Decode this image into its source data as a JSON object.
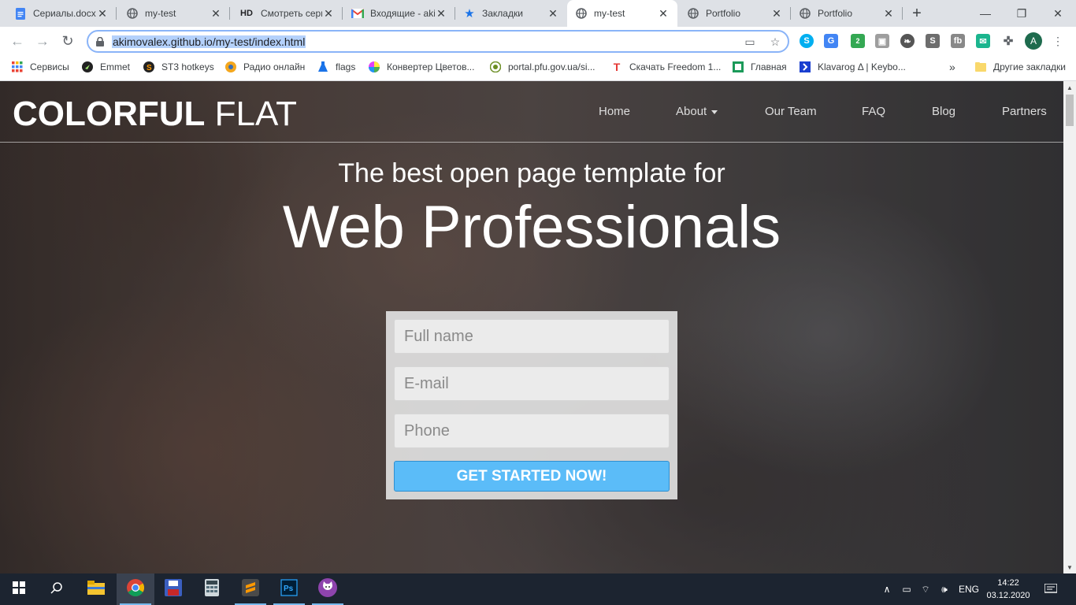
{
  "browser": {
    "tabs": [
      {
        "title": "Сериалы.docx - Google",
        "icon": "google-docs-icon",
        "color": "#4285f4"
      },
      {
        "title": "my-test",
        "icon": "globe-icon"
      },
      {
        "title": "Смотреть сериалы",
        "icon": "hd-icon"
      },
      {
        "title": "Входящие - akimov",
        "icon": "gmail-icon"
      },
      {
        "title": "Закладки",
        "icon": "star-icon"
      },
      {
        "title": "my-test",
        "icon": "globe-icon",
        "active": true
      },
      {
        "title": "Portfolio",
        "icon": "globe-icon"
      },
      {
        "title": "Portfolio",
        "icon": "globe-icon"
      }
    ],
    "url": "akimovalex.github.io/my-test/index.html",
    "profile_initial": "A",
    "extension_badge": "2",
    "bookmarks": [
      {
        "label": "Сервисы",
        "icon": "apps-grid-icon"
      },
      {
        "label": "Emmet",
        "icon": "emmet-icon"
      },
      {
        "label": "ST3 hotkeys",
        "icon": "sublime-icon"
      },
      {
        "label": "Радио онлайн",
        "icon": "radio-icon"
      },
      {
        "label": "flags",
        "icon": "flask-icon"
      },
      {
        "label": "Конвертер Цветов...",
        "icon": "color-wheel-icon"
      },
      {
        "label": "portal.pfu.gov.ua/si...",
        "icon": "emblem-icon"
      },
      {
        "label": "Скачать Freedom 1...",
        "icon": "t-logo-icon"
      },
      {
        "label": "Главная",
        "icon": "bank-icon"
      },
      {
        "label": "Klavarog Δ | Keybo...",
        "icon": "chevron-square-icon"
      }
    ],
    "other_bookmarks": "Другие закладки",
    "overflow": "»"
  },
  "site": {
    "logo_bold": "COLORFUL",
    "logo_light": "FLAT",
    "nav": [
      {
        "label": "Home"
      },
      {
        "label": "About",
        "dropdown": true
      },
      {
        "label": "Our Team"
      },
      {
        "label": "FAQ"
      },
      {
        "label": "Blog"
      },
      {
        "label": "Partners"
      }
    ],
    "hero_subtitle": "The best open page template for",
    "hero_title": "Web Professionals",
    "form": {
      "fullname_placeholder": "Full name",
      "email_placeholder": "E-mail",
      "phone_placeholder": "Phone",
      "cta": "GET STARTED NOW!"
    }
  },
  "taskbar": {
    "language": "ENG",
    "time": "14:22",
    "date": "03.12.2020"
  },
  "colors": {
    "cta": "#5bbcf8",
    "tabstrip": "#dee1e6",
    "taskbar": "#1c2430",
    "url_highlight": "#b4d1fb"
  }
}
